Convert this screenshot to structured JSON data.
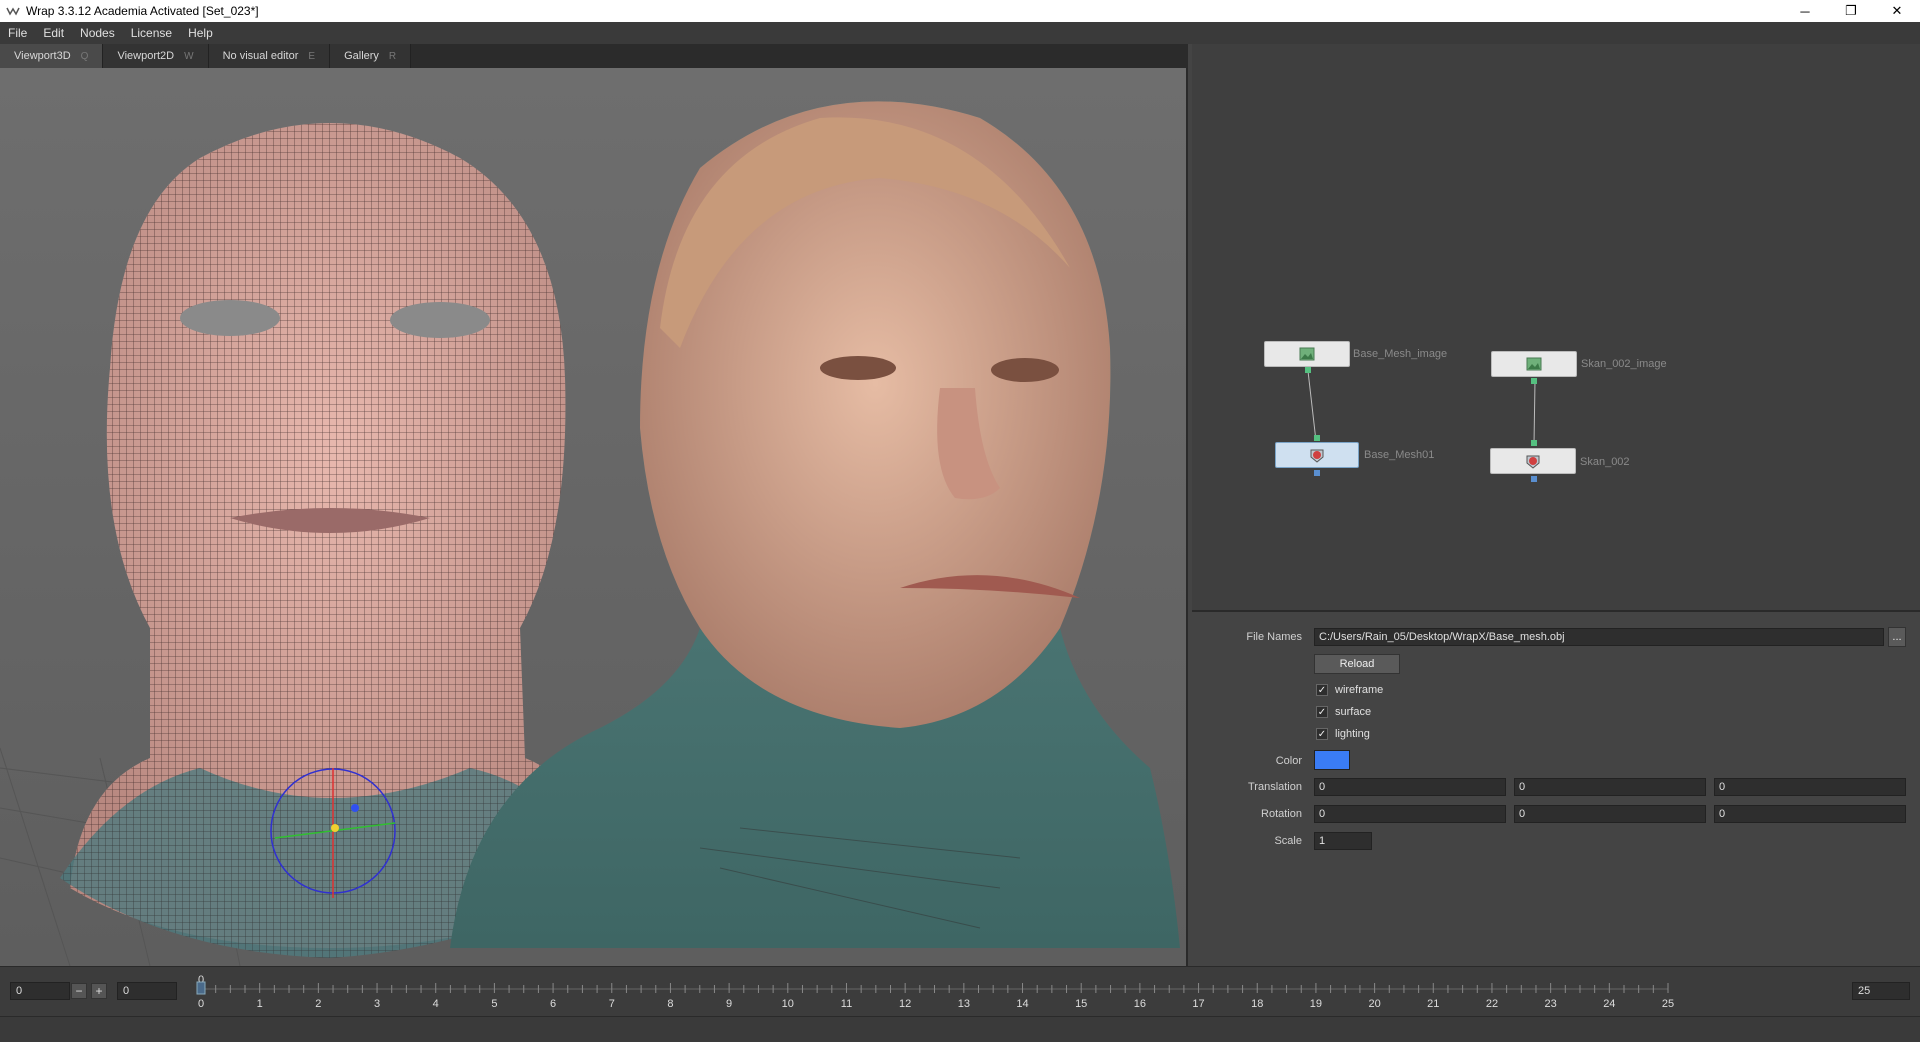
{
  "window": {
    "title": "Wrap 3.3.12 Academia Activated [Set_023*]"
  },
  "menu": [
    "File",
    "Edit",
    "Nodes",
    "License",
    "Help"
  ],
  "tabs": [
    {
      "label": "Viewport3D",
      "key": "Q"
    },
    {
      "label": "Viewport2D",
      "key": "W"
    },
    {
      "label": "No visual editor",
      "key": "E"
    },
    {
      "label": "Gallery",
      "key": "R"
    }
  ],
  "nodes": {
    "base_image": "Base_Mesh_image",
    "base_mesh": "Base_Mesh01",
    "scan_image": "Skan_002_image",
    "scan_mesh": "Skan_002"
  },
  "properties": {
    "file_names_label": "File Names",
    "file_names_value": "C:/Users/Rain_05/Desktop/WrapX/Base_mesh.obj",
    "browse_label": "...",
    "reload_label": "Reload",
    "wireframe_label": "wireframe",
    "surface_label": "surface",
    "lighting_label": "lighting",
    "check_mark": "✓",
    "color_label": "Color",
    "color_value": "#3a7cf5",
    "translation_label": "Translation",
    "translation": [
      "0",
      "0",
      "0"
    ],
    "rotation_label": "Rotation",
    "rotation": [
      "0",
      "0",
      "0"
    ],
    "scale_label": "Scale",
    "scale": "1"
  },
  "timeline": {
    "start_value": "0",
    "current_value": "0",
    "minus_label": "−",
    "plus_label": "+",
    "end_value": "25",
    "marker_label": "0",
    "ticks": [
      "0",
      "1",
      "2",
      "3",
      "4",
      "5",
      "6",
      "7",
      "8",
      "9",
      "10",
      "11",
      "12",
      "13",
      "14",
      "15",
      "16",
      "17",
      "18",
      "19",
      "20",
      "21",
      "22",
      "23",
      "24",
      "25"
    ]
  },
  "colors": {
    "accent": "#3a7cf5",
    "port_green": "#55c080"
  },
  "icons": {
    "close": "✕",
    "maximize": "❐",
    "minimize": "─"
  }
}
